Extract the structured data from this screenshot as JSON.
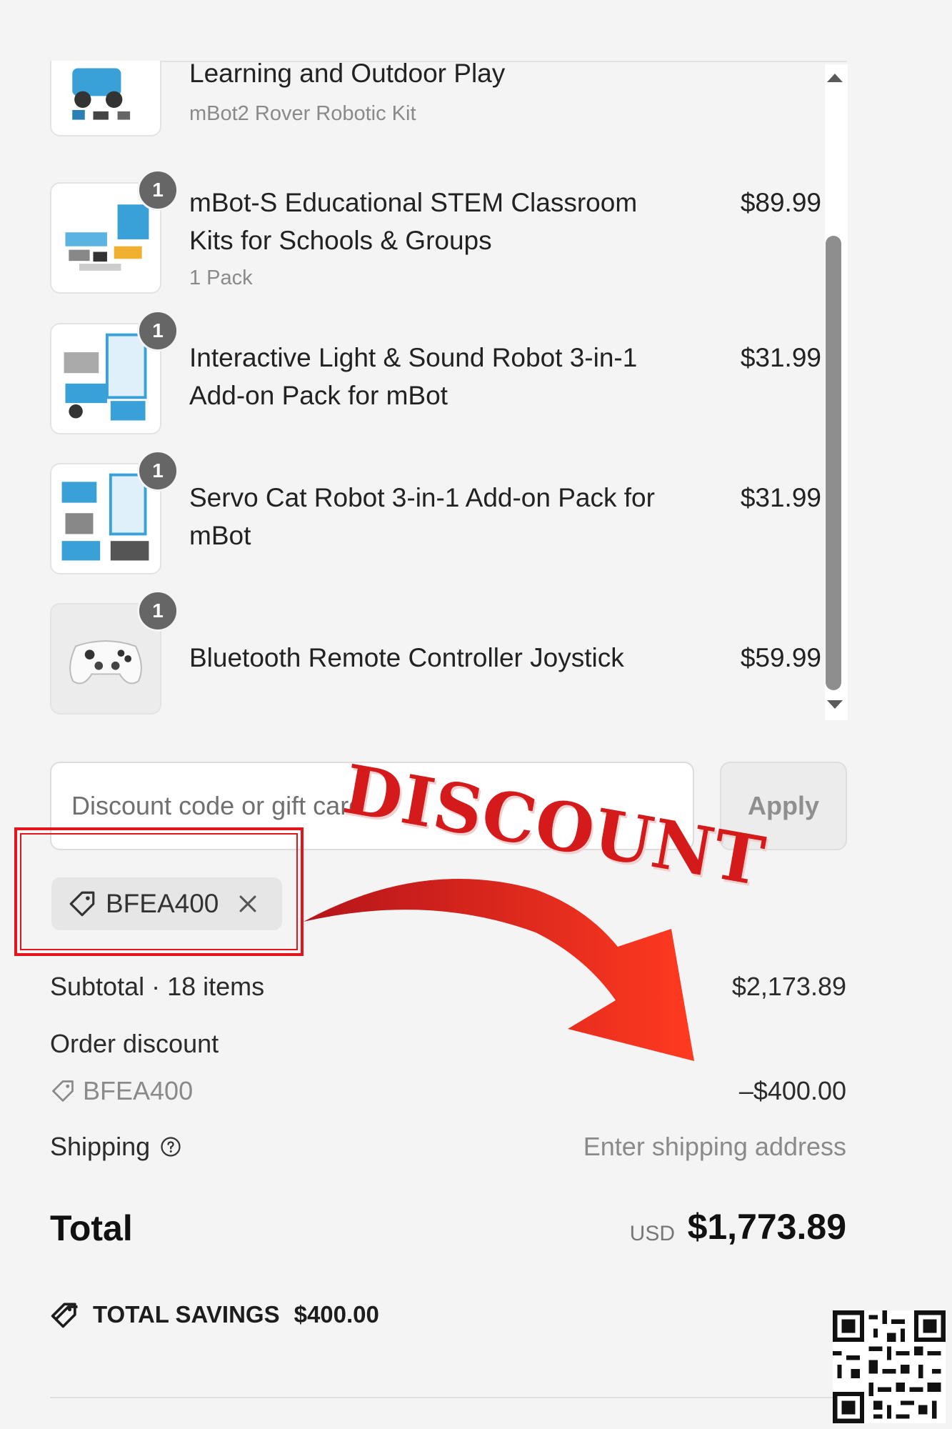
{
  "products": [
    {
      "name": "Kid's Interactive Emo Robot for Coding Learning and Outdoor Play",
      "variant": "mBot2 Rover Robotic Kit",
      "price": "",
      "qty": ""
    },
    {
      "name": "mBot-S Educational STEM Classroom Kits for Schools & Groups",
      "variant": "1 Pack",
      "price": "$89.99",
      "qty": "1"
    },
    {
      "name": "Interactive Light & Sound Robot 3-in-1 Add-on Pack for mBot",
      "variant": "",
      "price": "$31.99",
      "qty": "1"
    },
    {
      "name": "Servo Cat Robot 3-in-1 Add-on Pack for mBot",
      "variant": "",
      "price": "$31.99",
      "qty": "1"
    },
    {
      "name": "Bluetooth Remote Controller Joystick",
      "variant": "",
      "price": "$59.99",
      "qty": "1"
    }
  ],
  "discount": {
    "placeholder": "Discount code or gift card",
    "apply_label": "Apply",
    "applied_code": "BFEA400",
    "stamp_text": "DISCOUNT"
  },
  "summary": {
    "subtotal_label": "Subtotal · 18 items",
    "subtotal_value": "$2,173.89",
    "order_discount_label": "Order discount",
    "discount_code": "BFEA400",
    "discount_value": "–$400.00",
    "shipping_label": "Shipping",
    "shipping_value": "Enter shipping address",
    "total_label": "Total",
    "total_currency": "USD",
    "total_value": "$1,773.89",
    "savings_label": "TOTAL SAVINGS",
    "savings_value": "$400.00"
  },
  "colors": {
    "background": "#f4f4f4",
    "highlight_red": "#e3141c",
    "badge_grey": "#666666"
  },
  "icons": [
    "tag-icon",
    "close-icon",
    "help-circle-icon",
    "savings-tag-icon",
    "qr-code-icon"
  ]
}
